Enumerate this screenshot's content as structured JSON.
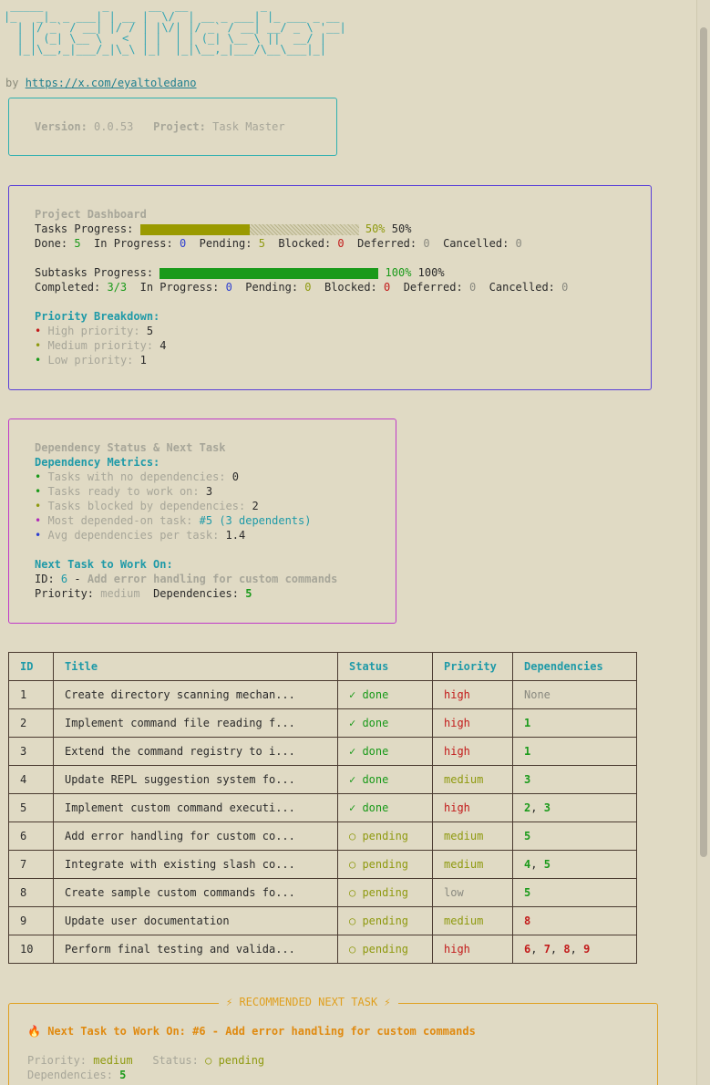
{
  "banner": {
    "ascii": " _____         _      __  __           _\n|_   _|_ _ ___| | __ |  \\/  | __ _ ___| |_ ___ _ __\n  | |/ _` / __| |/ / | |\\/| |/ _` / __| __/ _ \\ '__|\n  | | (_| \\__ \\   <  | |  | | (_| \\__ \\ ||  __/ |\n  |_|\\__,_|___/_|\\_\\ |_|  |_|\\__,_|___/\\__\\___|_|"
  },
  "byline": {
    "prefix": "by ",
    "link": "https://x.com/eyaltoledano"
  },
  "version_box": {
    "version_label": "Version:",
    "version": "0.0.53",
    "project_label": "Project:",
    "project": "Task Master"
  },
  "dashboard": {
    "title": "Project Dashboard",
    "tasks_label": "Tasks Progress:",
    "tasks_percent": 50,
    "tasks_percent_a": "50%",
    "tasks_percent_b": "50%",
    "done_label": "Done:",
    "done": "5",
    "inprog_label": "In Progress:",
    "inprog": "0",
    "pending_label": "Pending:",
    "pending": "5",
    "blocked_label": "Blocked:",
    "blocked": "0",
    "deferred_label": "Deferred:",
    "deferred": "0",
    "cancelled_label": "Cancelled:",
    "cancelled": "0",
    "sub_label": "Subtasks Progress:",
    "sub_percent": 100,
    "sub_percent_a": "100%",
    "sub_percent_b": "100%",
    "completed_label": "Completed:",
    "completed": "3/3",
    "s_inprog": "0",
    "s_pending": "0",
    "s_blocked": "0",
    "s_deferred": "0",
    "s_cancelled": "0",
    "priority_heading": "Priority Breakdown:",
    "high_label": "High priority:",
    "high": "5",
    "medium_label": "Medium priority:",
    "medium": "4",
    "low_label": "Low priority:",
    "low": "1",
    "bullet": "•"
  },
  "dependency": {
    "title": "Dependency Status & Next Task",
    "metrics_heading": "Dependency Metrics:",
    "no_deps_label": "Tasks with no dependencies:",
    "no_deps": "0",
    "ready_label": "Tasks ready to work on:",
    "ready": "3",
    "blocked_label": "Tasks blocked by dependencies:",
    "blocked": "2",
    "most_label": "Most depended-on task:",
    "most": "#5 (3 dependents)",
    "avg_label": "Avg dependencies per task:",
    "avg": "1.4",
    "next_heading": "Next Task to Work On:",
    "id_label": "ID:",
    "id": "6",
    "sep": " - ",
    "next_title": "Add error handling for custom commands",
    "priority_label": "Priority:",
    "priority": "medium",
    "deps_label": "Dependencies:",
    "deps": "5"
  },
  "table": {
    "headers": [
      "ID",
      "Title",
      "Status",
      "Priority",
      "Dependencies"
    ],
    "rows": [
      {
        "id": "1",
        "title": "Create directory scanning mechan...",
        "status": "✓ done",
        "priority": "high",
        "deps": [
          "None"
        ]
      },
      {
        "id": "2",
        "title": "Implement command file reading f...",
        "status": "✓ done",
        "priority": "high",
        "deps": [
          "1"
        ]
      },
      {
        "id": "3",
        "title": "Extend the command registry to i...",
        "status": "✓ done",
        "priority": "high",
        "deps": [
          "1"
        ]
      },
      {
        "id": "4",
        "title": "Update REPL suggestion system fo...",
        "status": "✓ done",
        "priority": "medium",
        "deps": [
          "3"
        ]
      },
      {
        "id": "5",
        "title": "Implement custom command executi...",
        "status": "✓ done",
        "priority": "high",
        "deps": [
          "2",
          "3"
        ]
      },
      {
        "id": "6",
        "title": "Add error handling for custom co...",
        "status": "○ pending",
        "priority": "medium",
        "deps": [
          "5"
        ]
      },
      {
        "id": "7",
        "title": "Integrate with existing slash co...",
        "status": "○ pending",
        "priority": "medium",
        "deps": [
          "4",
          "5"
        ]
      },
      {
        "id": "8",
        "title": "Create sample custom commands fo...",
        "status": "○ pending",
        "priority": "low",
        "deps": [
          "5"
        ]
      },
      {
        "id": "9",
        "title": "Update user documentation",
        "status": "○ pending",
        "priority": "medium",
        "deps": [
          "8"
        ]
      },
      {
        "id": "10",
        "title": "Perform final testing and valida...",
        "status": "○ pending",
        "priority": "high",
        "deps": [
          "6",
          "7",
          "8",
          "9"
        ]
      }
    ],
    "dep_separator": ", "
  },
  "recommended": {
    "title": "⚡ RECOMMENDED NEXT TASK ⚡",
    "fire": "🔥",
    "heading": "Next Task to Work On: #6 - Add error handling for custom commands",
    "priority_label": "Priority:",
    "priority": "medium",
    "status_label": "Status:",
    "status": "○ pending",
    "deps_label": "Dependencies:",
    "deps": "5"
  },
  "colors": {
    "background": "#e0dac4",
    "cyan": "#1f9aa8",
    "green": "#1a9a1a",
    "olive": "#8f9a10",
    "red": "#c21a1a",
    "blue": "#2d3fd0",
    "orange": "#e0a020",
    "magenta": "#b02ab8",
    "purple": "#5a3fd8"
  }
}
